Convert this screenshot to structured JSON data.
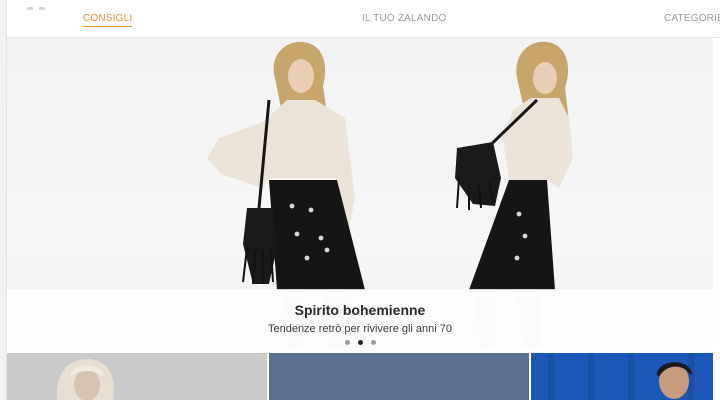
{
  "tabs": [
    {
      "label": "CONSIGLI",
      "active": true
    },
    {
      "label": "IL TUO ZALANDO",
      "active": false
    },
    {
      "label": "CATEGORIE",
      "active": false
    }
  ],
  "hero": {
    "title": "Spirito bohemienne",
    "subtitle": "Tendenze retrò per rivivere gli anni 70",
    "slides_total": 3,
    "active_slide": 2
  },
  "tiles": [
    {
      "name": "tile-blonde-model"
    },
    {
      "name": "tile-blue-grey"
    },
    {
      "name": "tile-blue-wall"
    }
  ],
  "colors": {
    "accent": "#e88b2e",
    "tab_inactive": "#9a9a9a",
    "tile_blue_grey": "#5b6f8e",
    "tile_blue": "#1c58b8"
  }
}
